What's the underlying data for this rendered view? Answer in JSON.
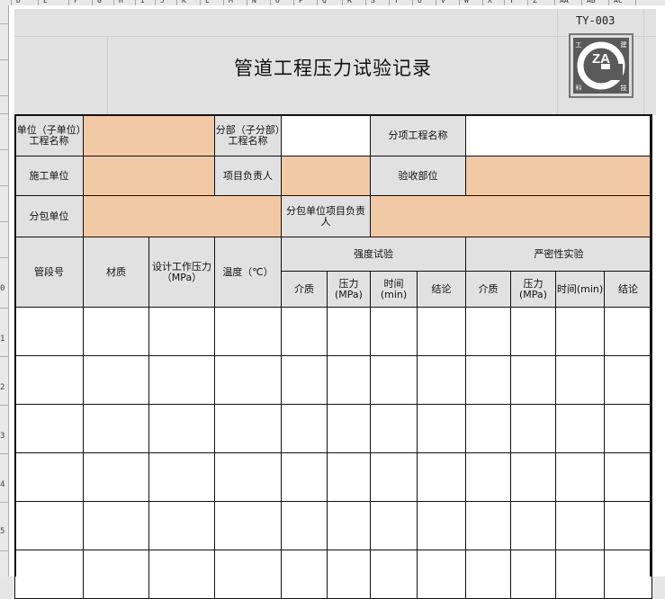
{
  "column_headers": [
    "D",
    "E",
    "F",
    "G",
    "H",
    "I",
    "J",
    "K",
    "L",
    "M",
    "N",
    "O",
    "P",
    "Q",
    "R",
    "S",
    "T",
    "U",
    "V",
    "W",
    "X",
    "Y",
    "Z",
    "AA",
    "AB",
    "AC"
  ],
  "row_numbers": [
    "0",
    "1",
    "2",
    "3",
    "4",
    "5"
  ],
  "header": {
    "title": "管道工程压力试验记录",
    "form_code": "TY-003",
    "logo": {
      "main": "ZA",
      "corners": [
        "工",
        "建",
        "科",
        "技"
      ]
    }
  },
  "info": {
    "unit_label": "单位（子单位）工程名称",
    "unit_value": "",
    "division_label": "分部（子分部）工程名称",
    "division_value": "",
    "item_label": "分项工程名称",
    "item_value": "",
    "contractor_label": "施工单位",
    "contractor_value": "",
    "pm_label": "项目负责人",
    "pm_value": "",
    "accept_label": "验收部位",
    "accept_value": "",
    "sub_label": "分包单位",
    "sub_value": "",
    "sub_pm_label": "分包单位项目负责人",
    "sub_pm_value": ""
  },
  "table": {
    "col_segment": "管段号",
    "col_material": "材质",
    "col_design_pressure": "设计工作压力（MPa）",
    "col_temperature": "温度（℃）",
    "group_strength": "强度试验",
    "group_tightness": "严密性实验",
    "sub_medium": "介质",
    "sub_pressure": "压力(MPa)",
    "sub_time": "时间(min)",
    "sub_result": "结论",
    "rows": [
      [
        "",
        "",
        "",
        "",
        "",
        "",
        "",
        "",
        "",
        "",
        "",
        ""
      ],
      [
        "",
        "",
        "",
        "",
        "",
        "",
        "",
        "",
        "",
        "",
        "",
        ""
      ],
      [
        "",
        "",
        "",
        "",
        "",
        "",
        "",
        "",
        "",
        "",
        "",
        ""
      ],
      [
        "",
        "",
        "",
        "",
        "",
        "",
        "",
        "",
        "",
        "",
        "",
        ""
      ],
      [
        "",
        "",
        "",
        "",
        "",
        "",
        "",
        "",
        "",
        "",
        "",
        ""
      ],
      [
        "",
        "",
        "",
        "",
        "",
        "",
        "",
        "",
        "",
        "",
        "",
        ""
      ]
    ]
  },
  "colors": {
    "label_bg": "#e1e1e1",
    "input_bg": "#f1c9a5",
    "border": "#111111"
  }
}
